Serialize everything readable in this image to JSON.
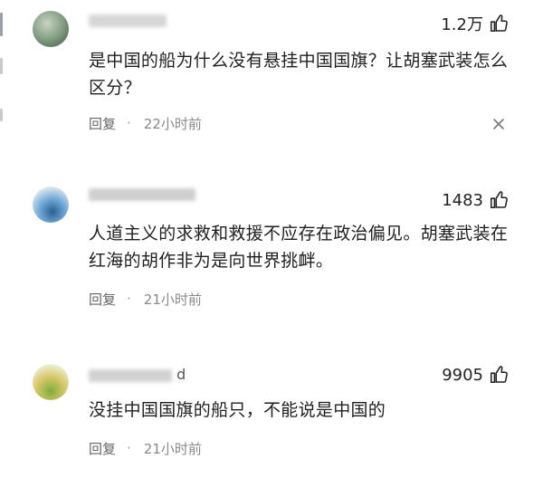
{
  "comments": [
    {
      "username_visible": "",
      "likes": "1.2万",
      "text": "是中国的船为什么没有悬挂中国国旗？让胡塞武装怎么区分？",
      "reply_label": "回复",
      "separator": "·",
      "time": "22小时前",
      "avatar_colors": [
        "#3d5a3a",
        "#8aa38a",
        "#c9d3c4"
      ]
    },
    {
      "username_visible": "",
      "likes": "1483",
      "text": "人道主义的求救和救援不应存在政治偏见。胡塞武装在红海的胡作非为是向世界挑衅。",
      "reply_label": "回复",
      "separator": "·",
      "time": "21小时前",
      "avatar_colors": [
        "#2d5f8f",
        "#6fa8d6",
        "#e6ecef"
      ]
    },
    {
      "username_visible": "d",
      "likes": "9905",
      "text": "没挂中国国旗的船只，不能说是中国的",
      "reply_label": "回复",
      "separator": "·",
      "time": "21小时前",
      "avatar_colors": [
        "#7fae3a",
        "#d8c86a",
        "#eef2e0"
      ]
    }
  ],
  "colors": {
    "text": "#1f1f1f",
    "meta": "#666666",
    "background": "#ffffff"
  },
  "icons": {
    "like": "thumbs-up-icon",
    "dismiss": "close-icon"
  }
}
